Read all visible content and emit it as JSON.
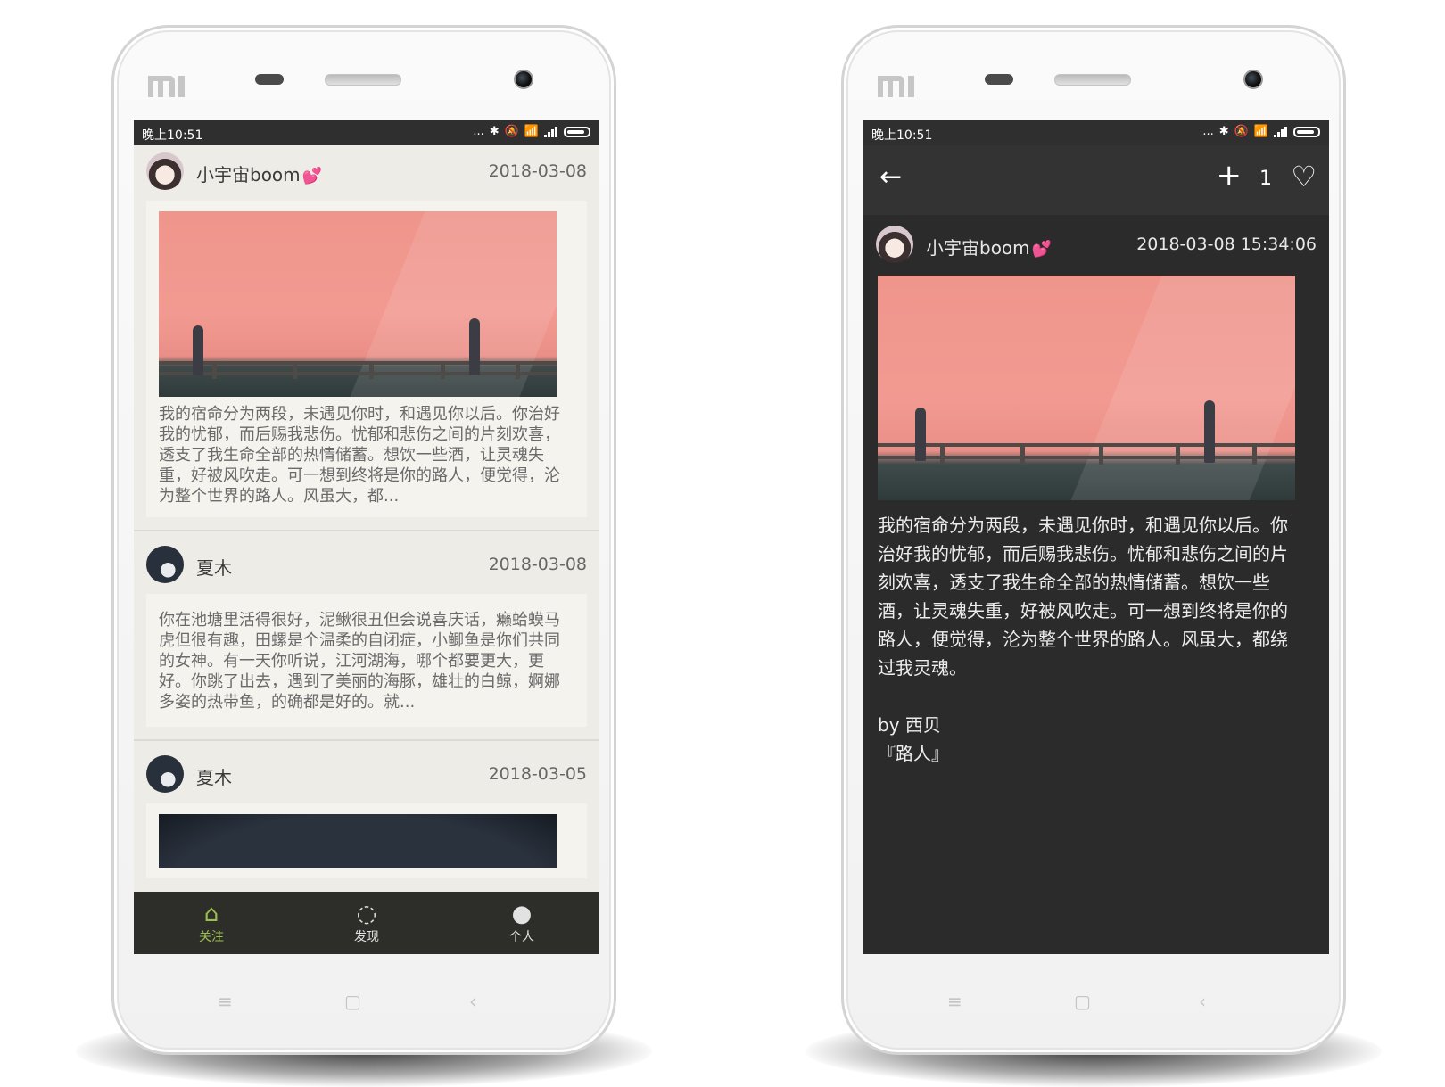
{
  "status_bar": {
    "time": "晚上10:51",
    "dots": "...",
    "bluetooth": "✱",
    "mute": "🔕",
    "wifi": "📶"
  },
  "feed": {
    "posts": [
      {
        "user": "小宇宙boom",
        "date": "2018-03-08",
        "excerpt": "我的宿命分为两段，未遇见你时，和遇见你以后。你治好我的忧郁，而后赐我悲伤。忧郁和悲伤之间的片刻欢喜，透支了我生命全部的热情储蓄。想饮一些酒，让灵魂失重，好被风吹走。可一想到终将是你的路人，便觉得，沦为整个世界的路人。风虽大，都..."
      },
      {
        "user": "夏木",
        "date": "2018-03-08",
        "excerpt": "你在池塘里活得很好，泥鳅很丑但会说喜庆话，癞蛤蟆马虎但很有趣，田螺是个温柔的自闭症，小鲫鱼是你们共同的女神。有一天你听说，江河湖海，哪个都要更大，更好。你跳了出去，遇到了美丽的海豚，雄壮的白鲸，婀娜多姿的热带鱼，的确都是好的。就..."
      },
      {
        "user": "夏木",
        "date": "2018-03-05"
      }
    ]
  },
  "bottom_nav": {
    "tabs": [
      {
        "label": "关注",
        "icon": "home-icon"
      },
      {
        "label": "发现",
        "icon": "discover-icon"
      },
      {
        "label": "个人",
        "icon": "person-icon"
      }
    ]
  },
  "detail": {
    "like_count": "1",
    "user": "小宇宙boom",
    "datetime": "2018-03-08 15:34:06",
    "text": "我的宿命分为两段，未遇见你时，和遇见你以后。你治好我的忧郁，而后赐我悲伤。忧郁和悲伤之间的片刻欢喜，透支了我生命全部的热情储蓄。想饮一些酒，让灵魂失重，好被风吹走。可一想到终将是你的路人，便觉得，沦为整个世界的路人。风虽大，都绕过我灵魂。",
    "author": "by 西贝",
    "source": "『路人』"
  },
  "colors": {
    "accent": "#9dbf50",
    "feed_bg": "#eeece6",
    "detail_bg": "#2b2b2b"
  }
}
